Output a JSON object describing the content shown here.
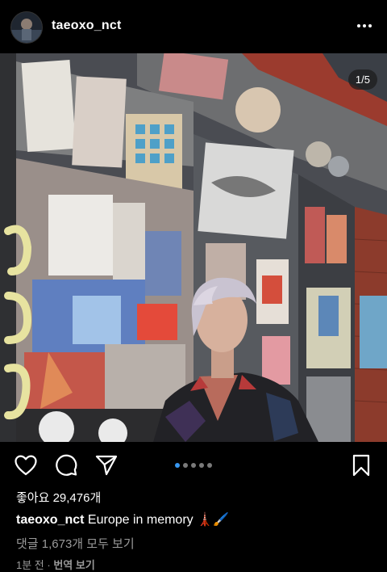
{
  "post": {
    "username": "taeoxo_nct",
    "image_counter": "1/5",
    "carousel": {
      "count": 5,
      "active": 0
    },
    "likes_text": "좋아요 29,476개",
    "caption_username": "taeoxo_nct",
    "caption_text": "Europe in memory 🗼🖌️",
    "comments_text": "댓글 1,673개 모두 보기",
    "time_text": "1분 전 · ",
    "translate_text": "번역 보기"
  },
  "icons": {
    "more": "more-horizontal-icon",
    "like": "heart-icon",
    "comment": "comment-icon",
    "share": "paper-plane-icon",
    "save": "bookmark-icon"
  },
  "colors": {
    "background": "#000000",
    "text": "#ffffff",
    "muted": "#9a9a9a",
    "carousel_active": "#3897f0",
    "carousel_inactive": "#7a7a7a"
  }
}
